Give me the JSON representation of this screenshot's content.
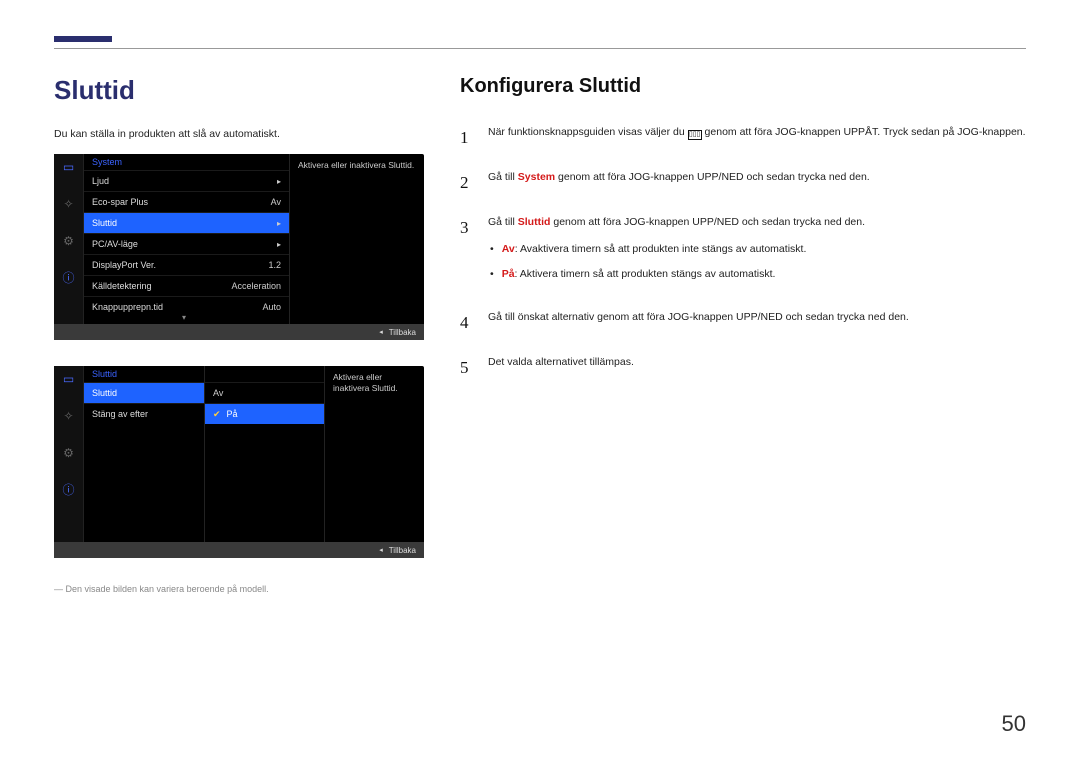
{
  "main_title": "Sluttid",
  "intro": "Du kan ställa in produkten att slå av automatiskt.",
  "osd1": {
    "header": "System",
    "rows": [
      {
        "label": "Ljud",
        "value": "",
        "arrow": true,
        "selected": false
      },
      {
        "label": "Eco-spar Plus",
        "value": "Av",
        "arrow": false,
        "selected": false
      },
      {
        "label": "Sluttid",
        "value": "",
        "arrow": true,
        "selected": true
      },
      {
        "label": "PC/AV-läge",
        "value": "",
        "arrow": true,
        "selected": false
      },
      {
        "label": "DisplayPort Ver.",
        "value": "1.2",
        "arrow": false,
        "selected": false
      },
      {
        "label": "Källdetektering",
        "value": "Acceleration",
        "arrow": false,
        "selected": false
      },
      {
        "label": "Knappupprepn.tid",
        "value": "Auto",
        "arrow": false,
        "selected": false
      }
    ],
    "desc": "Aktivera eller inaktivera Sluttid.",
    "back": "Tillbaka"
  },
  "osd2": {
    "header": "Sluttid",
    "rows": [
      {
        "label": "Sluttid",
        "selected": true
      },
      {
        "label": "Stäng av efter",
        "selected": false
      }
    ],
    "options": [
      {
        "label": "Av",
        "selected": false
      },
      {
        "label": "På",
        "selected": true
      }
    ],
    "desc": "Aktivera eller inaktivera Sluttid.",
    "back": "Tillbaka"
  },
  "footnote": "― Den visade bilden kan variera beroende på modell.",
  "right_title": "Konfigurera Sluttid",
  "steps": {
    "s1_a": "När funktionsknappsguiden visas väljer du ",
    "s1_b": " genom att föra JOG-knappen UPPÅT. Tryck sedan på JOG-knappen.",
    "s2_a": "Gå till ",
    "s2_b": "System",
    "s2_c": " genom att föra JOG-knappen UPP/NED och sedan trycka ned den.",
    "s3_a": "Gå till ",
    "s3_b": "Sluttid",
    "s3_c": " genom att föra JOG-knappen UPP/NED och sedan trycka ned den.",
    "b1_a": "Av",
    "b1_b": ": Avaktivera timern så att produkten inte stängs av automatiskt.",
    "b2_a": "På",
    "b2_b": ": Aktivera timern så att produkten stängs av automatiskt.",
    "s4": "Gå till önskat alternativ genom att föra JOG-knappen UPP/NED och sedan trycka ned den.",
    "s5": "Det valda alternativet tillämpas."
  },
  "page_number": "50"
}
